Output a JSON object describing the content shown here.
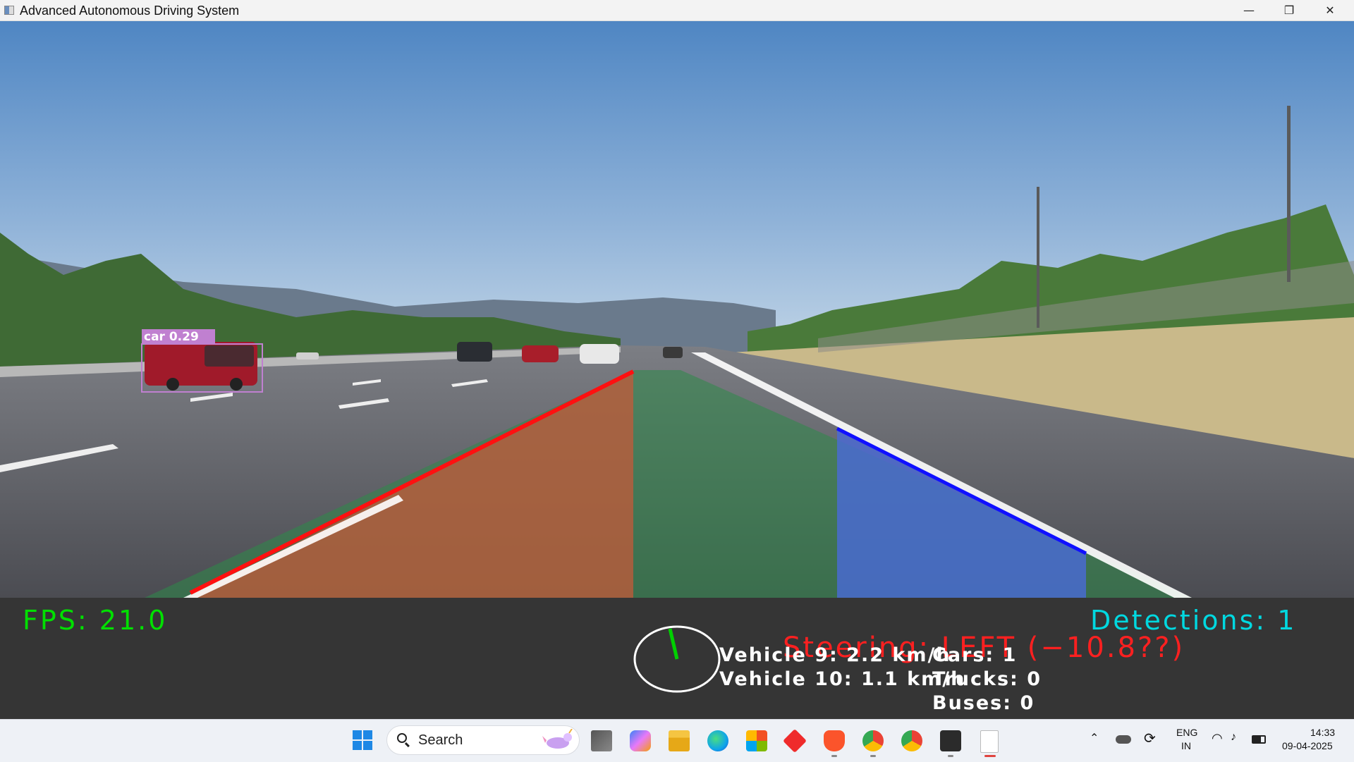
{
  "window": {
    "title": "Advanced Autonomous Driving System",
    "controls": {
      "minimize": "—",
      "maximize": "❐",
      "close": "✕"
    }
  },
  "video": {
    "detection_label": "car 0.29",
    "detection_box_color": "#c080d0",
    "left_lane_color": "#ff1010",
    "right_lane_color": "#1010ff"
  },
  "hud": {
    "fps": "FPS: 21.0",
    "detections": "Detections: 1",
    "steering": "Steering: LEFT (−10.8??)",
    "vehicles": [
      "Vehicle 9: 2.2 km/h",
      "Vehicle 10: 1.1 km/h"
    ],
    "counts": {
      "cars": "Cars: 1",
      "trucks": "Trucks: 0",
      "buses": "Buses: 0"
    },
    "colors": {
      "fps": "#00e000",
      "detections": "#00d8e0",
      "steering": "#ff2020",
      "gauge_needle": "#00d000"
    }
  },
  "taskbar": {
    "search_label": "Search",
    "apps": [
      "task-view-icon",
      "copilot-icon",
      "file-explorer-icon",
      "edge-icon",
      "store-icon",
      "app-red-diamond-icon",
      "brave-icon",
      "chrome-profile-icon",
      "chrome-icon",
      "terminal-icon",
      "notepad-icon"
    ],
    "tray": {
      "language_line1": "ENG",
      "language_line2": "IN",
      "time": "14:33",
      "date": "09-04-2025"
    }
  }
}
